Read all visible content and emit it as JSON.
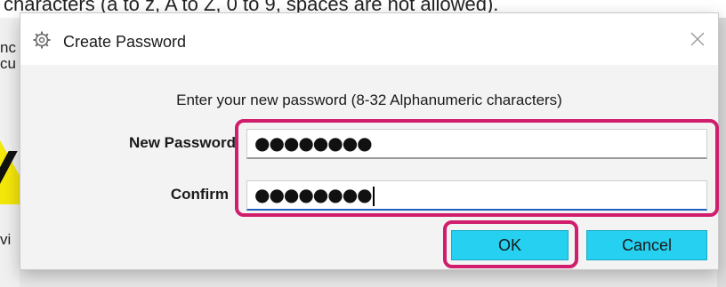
{
  "background": {
    "top_text": "characters (a to z, A to Z, 0 to 9, spaces are not allowed).",
    "left_fragments": [
      "nc",
      "cu",
      "vi"
    ]
  },
  "dialog": {
    "title": "Create Password",
    "icon": "gear-app-icon",
    "close_icon": "close-icon",
    "instruction": "Enter your new password (8-32 Alphanumeric characters)",
    "new_password": {
      "label": "New Password",
      "value": "●●●●●●●●"
    },
    "confirm": {
      "label": "Confirm",
      "value": "●●●●●●●●"
    },
    "ok_label": "OK",
    "cancel_label": "Cancel"
  },
  "colors": {
    "button_fill": "#25d0f0",
    "highlight": "#d01e6d",
    "warning": "#f4e70a"
  }
}
